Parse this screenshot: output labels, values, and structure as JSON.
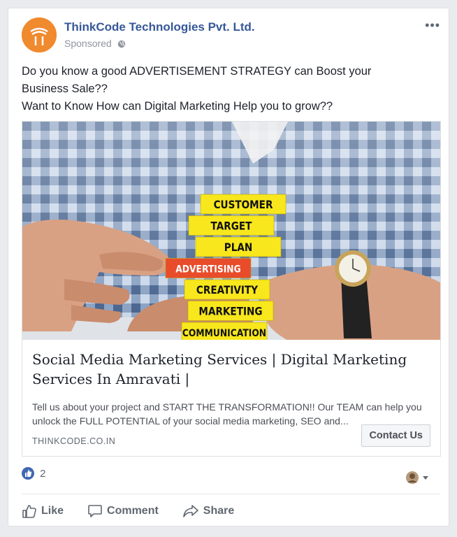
{
  "post": {
    "page_name": "ThinkCode Technologies Pvt. Ltd.",
    "sponsored_label": "Sponsored",
    "menu_label": "•••",
    "text_lines": [
      "Do you know a good ADVERTISEMENT STRATEGY can Boost your",
      "Business Sale??",
      "Want to Know How can Digital Marketing Help you to grow??"
    ]
  },
  "image": {
    "blocks": [
      "CUSTOMER",
      "TARGET",
      "PLAN",
      "ADVERTISING",
      "CREATIVITY",
      "MARKETING",
      "COMMUNICATION"
    ],
    "block_color": "#f8e71c",
    "highlight_color": "#e84c2a"
  },
  "link_preview": {
    "title": "Social Media Marketing Services | Digital Marketing Services In Amravati |",
    "description": "Tell us about your project and START THE TRANSFORMATION!! Our TEAM can help you unlock the FULL POTENTIAL of your social media marketing, SEO and...",
    "domain": "THINKCODE.CO.IN",
    "cta_label": "Contact Us"
  },
  "reactions": {
    "like_count": "2"
  },
  "actions": {
    "like_label": "Like",
    "comment_label": "Comment",
    "share_label": "Share"
  },
  "colors": {
    "brand_link": "#365899",
    "like_blue": "#4267b2",
    "avatar_orange": "#f08a2e"
  }
}
